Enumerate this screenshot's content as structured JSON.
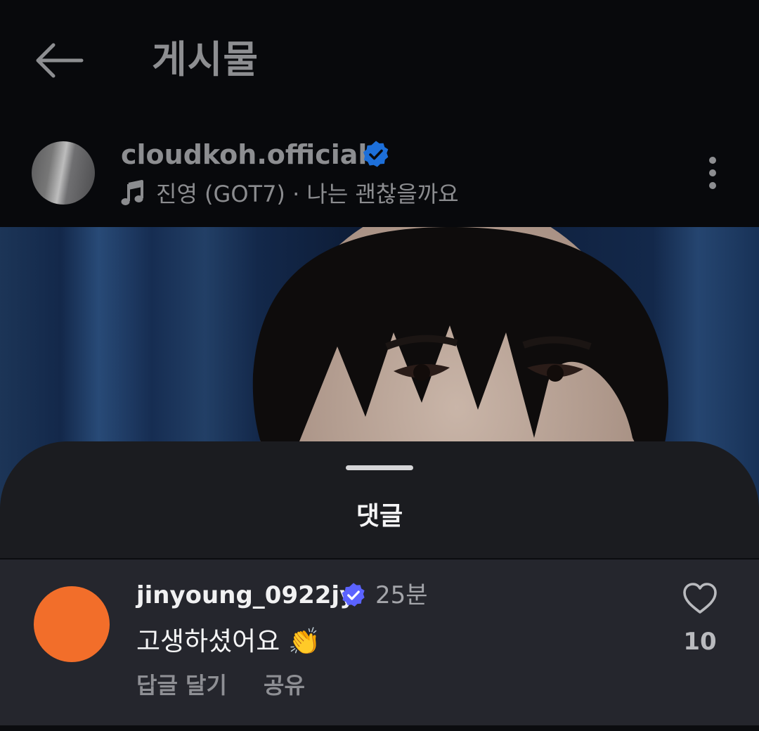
{
  "header": {
    "title": "게시물",
    "back_icon": "arrow-left-icon"
  },
  "post": {
    "username": "cloudkoh.official",
    "verified": true,
    "music": {
      "icon": "music-note-icon",
      "text": "진영 (GOT7) · 나는 괜찮을까요"
    },
    "more_icon": "more-vertical-icon"
  },
  "comments_sheet": {
    "title": "댓글",
    "comments": [
      {
        "username": "jinyoung_0922jy",
        "verified": true,
        "time": "25분",
        "text": "고생하셨어요 👏",
        "like_count": "10",
        "reply_label": "답글 달기",
        "share_label": "공유",
        "avatar_color": "#f26e2a"
      }
    ]
  },
  "colors": {
    "verified_dark": "#1d6fd9",
    "verified_bright": "#5b63ff",
    "background": "#08090c",
    "sheet": "#1b1c20"
  }
}
